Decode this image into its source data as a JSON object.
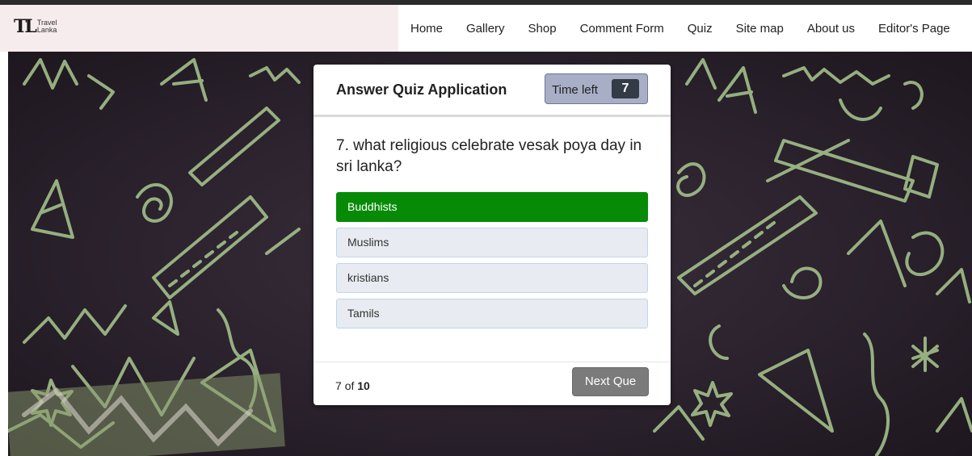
{
  "brand": {
    "mark": "TL",
    "line1": "Travel",
    "line2": "Lanka"
  },
  "nav": [
    {
      "label": "Home"
    },
    {
      "label": "Gallery"
    },
    {
      "label": "Shop"
    },
    {
      "label": "Comment Form"
    },
    {
      "label": "Quiz"
    },
    {
      "label": "Site map"
    },
    {
      "label": "About us"
    },
    {
      "label": "Editor's Page"
    }
  ],
  "quiz": {
    "title": "Answer Quiz Application",
    "timer_label": "Time left",
    "timer_value": "7",
    "question_number": "7.",
    "question_text": "what religious celebrate vesak poya day in sri lanka?",
    "options": [
      {
        "label": "Buddhists",
        "state": "correct"
      },
      {
        "label": "Muslims",
        "state": "default"
      },
      {
        "label": "kristians",
        "state": "default"
      },
      {
        "label": "Tamils",
        "state": "default"
      }
    ],
    "progress_current": "7",
    "progress_of": "of",
    "progress_total": "10",
    "next_label": "Next Que"
  },
  "colors": {
    "correct": "#078b07",
    "option_bg": "#e8ebf1",
    "background": "#2c2330",
    "doodle": "#a9c98f"
  }
}
